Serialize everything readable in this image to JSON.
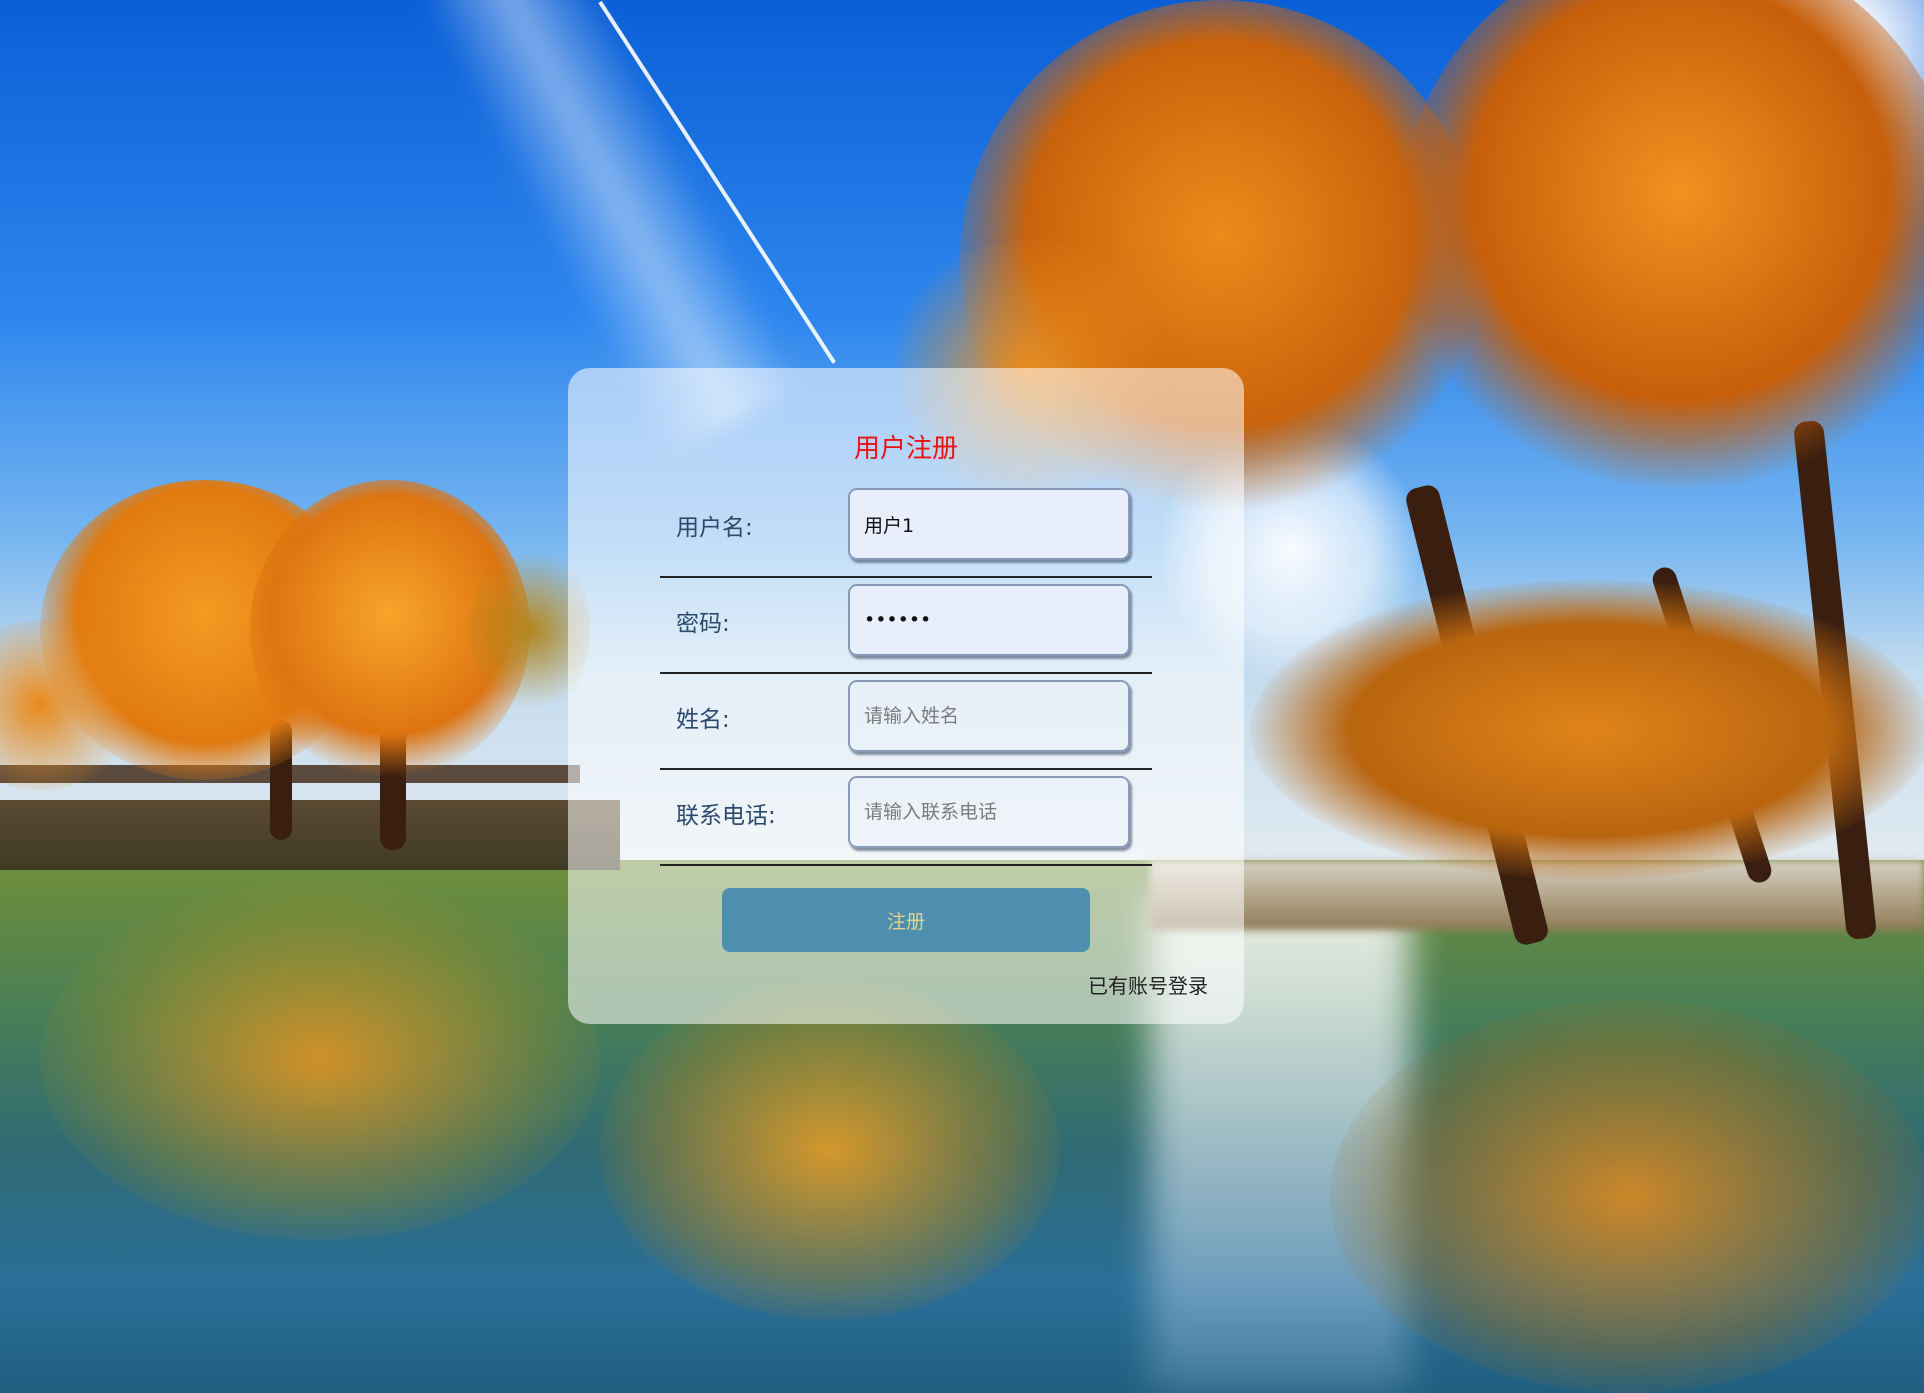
{
  "background": {
    "description_icon": "autumn-lake-landscape"
  },
  "form": {
    "title": "用户注册",
    "fields": [
      {
        "label": "用户名:",
        "value": "用户1",
        "placeholder": "",
        "type": "text"
      },
      {
        "label": "密码:",
        "value": "abcdef",
        "placeholder": "",
        "type": "password"
      },
      {
        "label": "姓名:",
        "value": "",
        "placeholder": "请输入姓名",
        "type": "text"
      },
      {
        "label": "联系电话:",
        "value": "",
        "placeholder": "请输入联系电话",
        "type": "text"
      }
    ],
    "submit_label": "注册",
    "login_link_label": "已有账号登录"
  },
  "colors": {
    "title": "#ee1111",
    "label": "#2b4a6e",
    "button_bg": "#4e8fb0",
    "button_text": "#e2d28a",
    "card_bg": "rgba(255,255,255,0.55)"
  }
}
